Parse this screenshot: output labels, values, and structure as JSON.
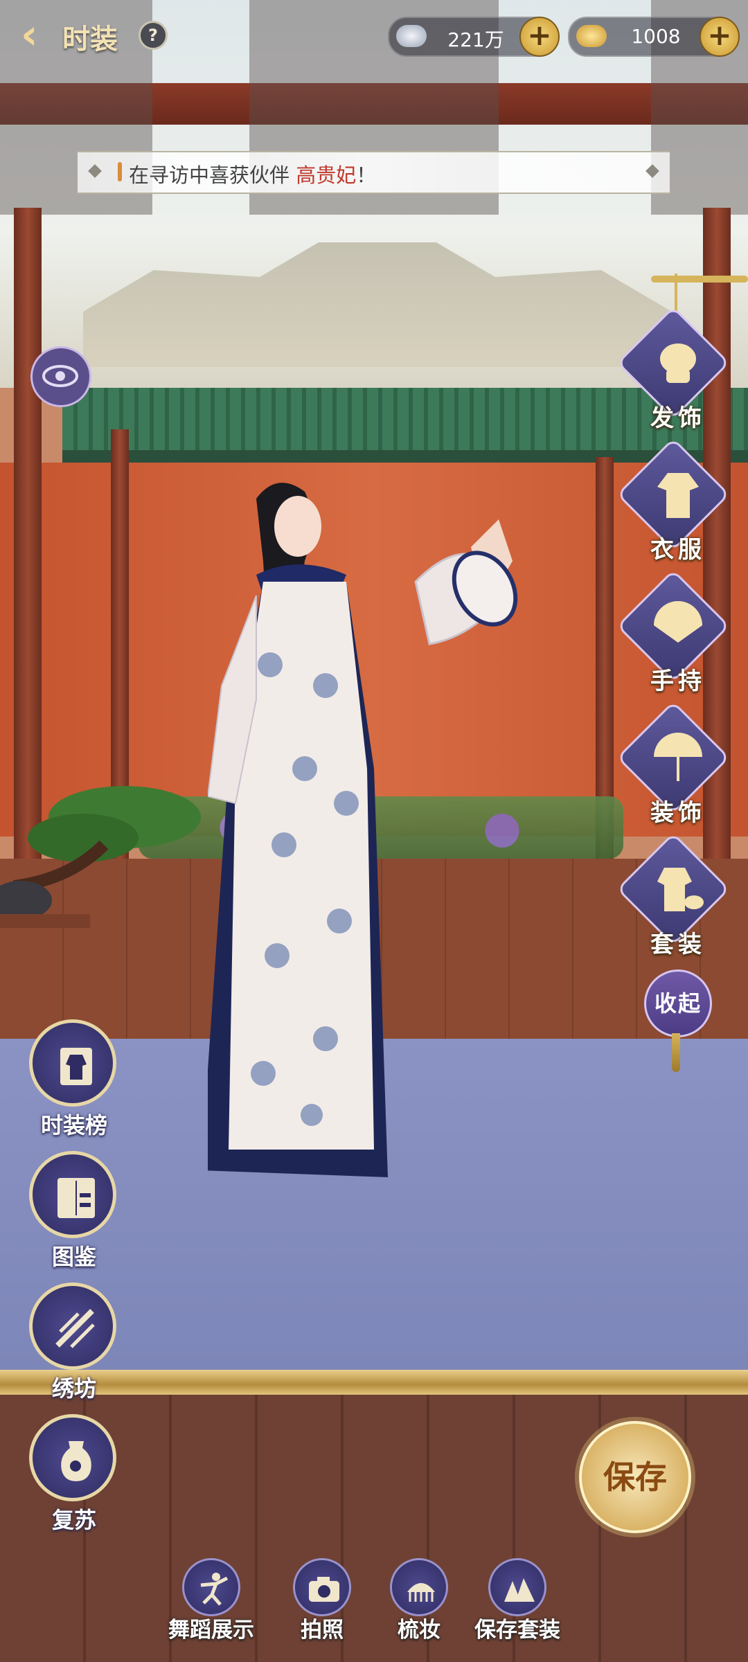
{
  "header": {
    "title": "时装",
    "help_label": "?",
    "back_icon": "chevron-left-icon"
  },
  "currencies": [
    {
      "name": "silver",
      "icon": "silver-ingot-icon",
      "value": "221万",
      "plus_label": "+"
    },
    {
      "name": "gold",
      "icon": "gold-ingot-icon",
      "value": "1008",
      "plus_label": "+"
    }
  ],
  "notice": {
    "prefix": "在寻访中喜获伙伴 ",
    "highlight": "高贵妃",
    "suffix": "！",
    "highlight_color": "#c0392b"
  },
  "categories": [
    {
      "label": "发饰",
      "icon": "hair-ornament-icon"
    },
    {
      "label": "衣服",
      "icon": "clothes-icon"
    },
    {
      "label": "手持",
      "icon": "fan-icon"
    },
    {
      "label": "装饰",
      "icon": "umbrella-icon"
    },
    {
      "label": "套装",
      "icon": "outfit-set-icon"
    }
  ],
  "collapse_label": "收起",
  "side_buttons": [
    {
      "label": "时装榜",
      "icon": "ranking-scroll-icon"
    },
    {
      "label": "图鉴",
      "icon": "wardrobe-icon"
    },
    {
      "label": "绣坊",
      "icon": "embroidery-needle-icon"
    },
    {
      "label": "复苏",
      "icon": "vase-flower-icon"
    }
  ],
  "save_label": "保存",
  "bottom_buttons": [
    {
      "label": "舞蹈展示",
      "icon": "dance-icon"
    },
    {
      "label": "拍照",
      "icon": "camera-icon"
    },
    {
      "label": "梳妆",
      "icon": "comb-icon"
    },
    {
      "label": "保存套装",
      "icon": "save-outfit-icon"
    }
  ],
  "colors": {
    "accent_gold": "#e7d7a6",
    "button_purple": "#3d3972",
    "highlight_red": "#c0392b"
  }
}
